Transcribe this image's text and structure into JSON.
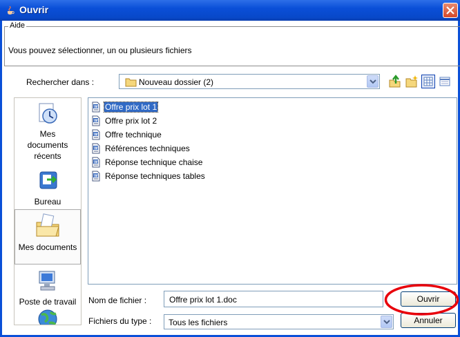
{
  "window": {
    "title": "Ouvrir"
  },
  "aide": {
    "legend": "Aide",
    "text": "Vous pouvez sélectionner, un ou plusieurs fichiers"
  },
  "look_in": {
    "label": "Rechercher dans :",
    "value": "Nouveau dossier (2)"
  },
  "toolbar": {
    "icons": [
      "up-folder-icon",
      "new-folder-icon",
      "list-view-icon",
      "details-view-icon"
    ]
  },
  "places": [
    {
      "label": "Mes documents récents",
      "lines": [
        "Mes",
        "documents",
        "récents"
      ],
      "icon": "recent-documents-icon"
    },
    {
      "label": "Bureau",
      "icon": "desktop-icon"
    },
    {
      "label": "Mes documents",
      "icon": "my-documents-icon"
    },
    {
      "label": "Poste de travail",
      "icon": "my-computer-icon"
    },
    {
      "label": "",
      "icon": "network-icon"
    }
  ],
  "files": [
    {
      "name": "Offre prix lot 1",
      "selected": true
    },
    {
      "name": "Offre prix lot 2"
    },
    {
      "name": "Offre technique"
    },
    {
      "name": "Références techniques"
    },
    {
      "name": "Réponse technique chaise"
    },
    {
      "name": "Réponse techniques tables"
    }
  ],
  "file_name": {
    "label": "Nom de fichier :",
    "value": "Offre prix lot 1.doc"
  },
  "file_type": {
    "label": "Fichiers du type :",
    "value": "Tous les fichiers"
  },
  "buttons": {
    "open": "Ouvrir",
    "cancel": "Annuler"
  },
  "colors": {
    "titlebar": "#0a4fd8",
    "selection": "#316ac5",
    "highlight_ring": "#e8000b",
    "close_button": "#d5482a"
  }
}
